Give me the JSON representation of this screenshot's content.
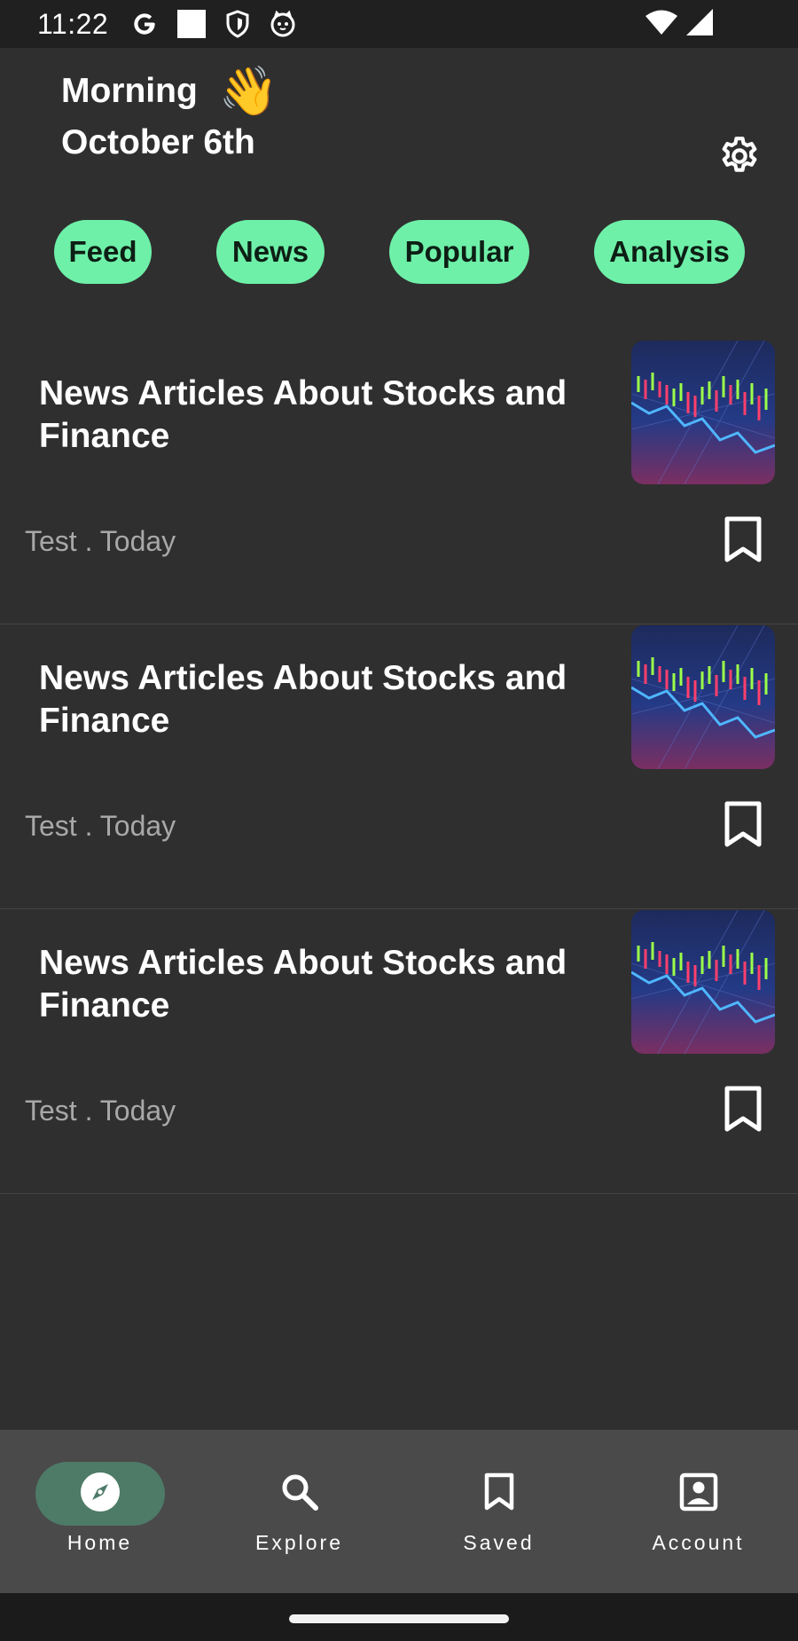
{
  "status_bar": {
    "time": "11:22",
    "icons": [
      "google-icon",
      "square-notification-icon",
      "shield-icon",
      "cat-face-icon",
      "wifi-icon",
      "signal-icon"
    ]
  },
  "header": {
    "greeting": "Morning",
    "wave_emoji": "👋",
    "date": "October 6th",
    "settings_icon": "gear-icon"
  },
  "chips": [
    {
      "label": "Feed"
    },
    {
      "label": "News"
    },
    {
      "label": "Popular"
    },
    {
      "label": "Analysis"
    }
  ],
  "articles": [
    {
      "title": "News Articles About Stocks and Finance",
      "meta": "Test . Today",
      "thumbnail": "stock-chart-image",
      "bookmark_icon": "bookmark-icon"
    },
    {
      "title": "News Articles About Stocks and Finance",
      "meta": "Test . Today",
      "thumbnail": "stock-chart-image",
      "bookmark_icon": "bookmark-icon"
    },
    {
      "title": "News Articles About Stocks and Finance",
      "meta": "Test . Today",
      "thumbnail": "stock-chart-image",
      "bookmark_icon": "bookmark-icon"
    }
  ],
  "bottom_nav": [
    {
      "label": "Home",
      "icon": "compass-icon",
      "active": true
    },
    {
      "label": "Explore",
      "icon": "search-icon",
      "active": false
    },
    {
      "label": "Saved",
      "icon": "bookmark-icon",
      "active": false
    },
    {
      "label": "Account",
      "icon": "account-box-icon",
      "active": false
    }
  ],
  "colors": {
    "background": "#2f2f2f",
    "status_bar": "#202020",
    "chip": "#6ef0a8",
    "chip_text": "#0d1f15",
    "nav_bar": "#4a4a4a",
    "nav_active_pill": "#4e7a68",
    "meta_text": "#a8a8a8"
  }
}
